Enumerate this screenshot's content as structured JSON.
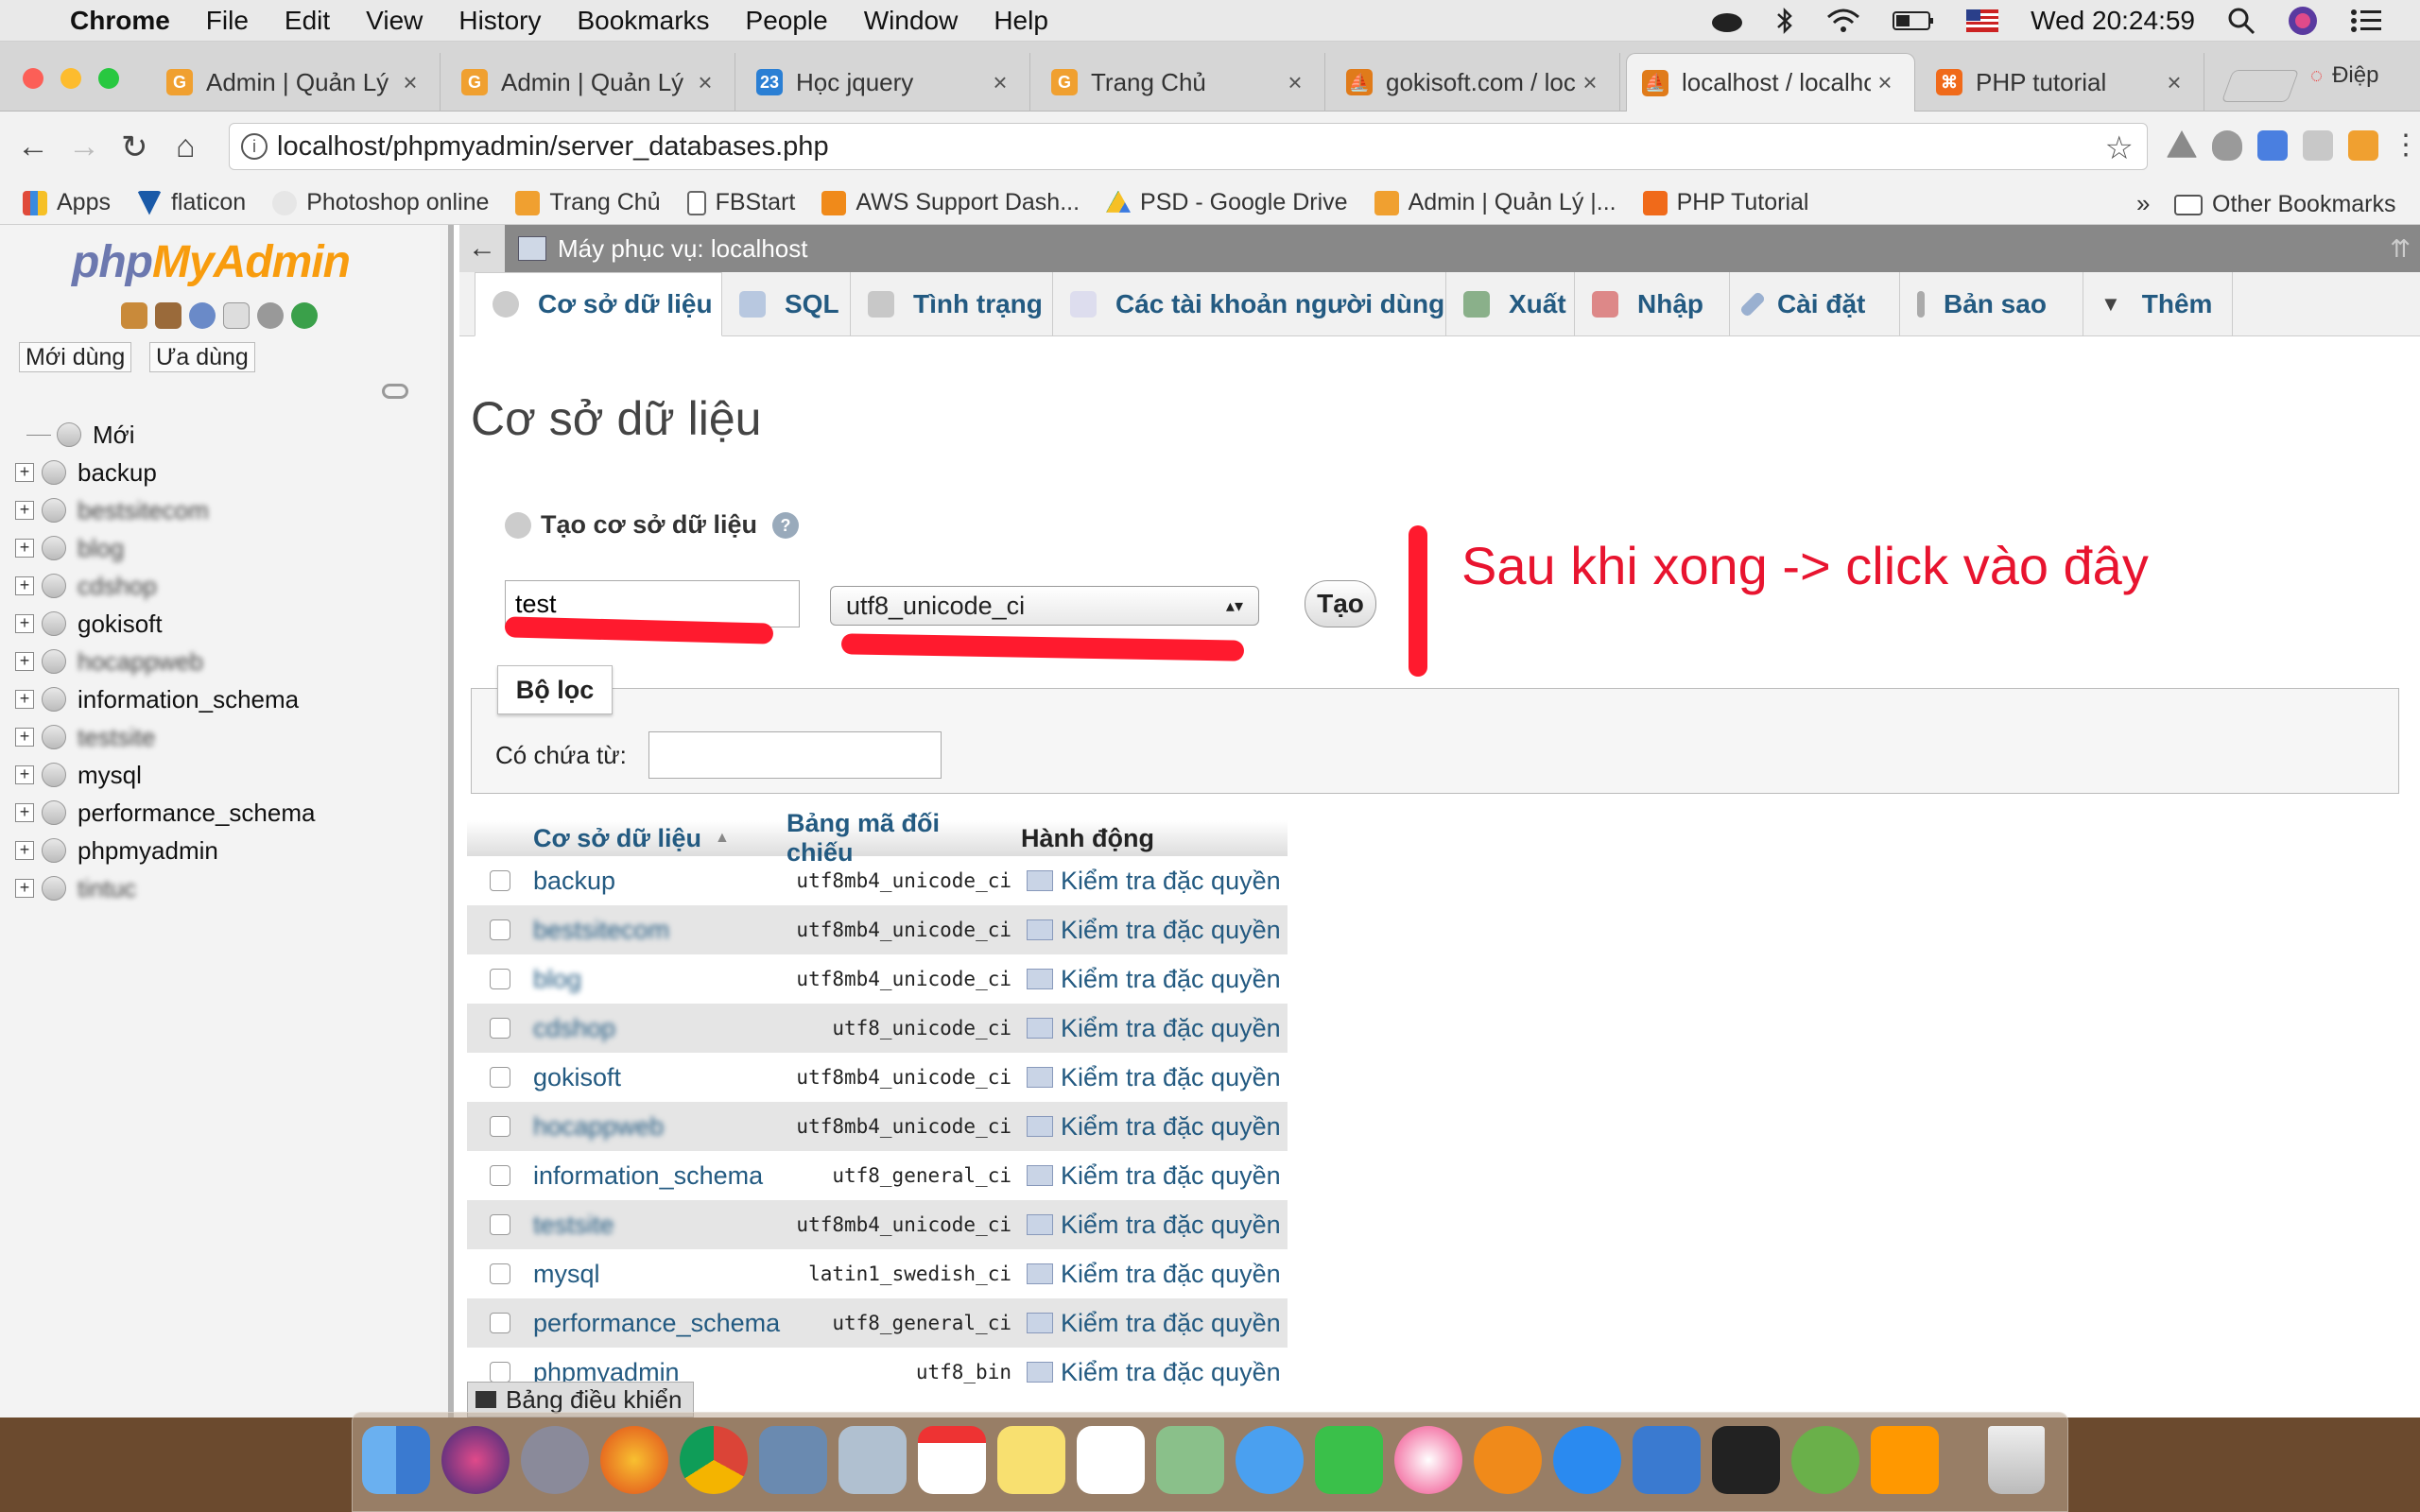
{
  "menubar": {
    "apple": "",
    "app_name": "Chrome",
    "menus": [
      "File",
      "Edit",
      "View",
      "History",
      "Bookmarks",
      "People",
      "Window",
      "Help"
    ],
    "clock": "Wed 20:24:59"
  },
  "tabs": [
    {
      "title": "Admin | Quản Lý |",
      "fav": "#f0a030"
    },
    {
      "title": "Admin | Quản Lý |",
      "fav": "#f0a030"
    },
    {
      "title": "Học jquery",
      "fav": "#2a7fd4"
    },
    {
      "title": "Trang Chủ",
      "fav": "#f0a030"
    },
    {
      "title": "gokisoft.com / loc",
      "fav": "#e07b1a"
    },
    {
      "title": "localhost / localho",
      "fav": "#e07b1a"
    },
    {
      "title": "PHP tutorial",
      "fav": "#f06a1a"
    }
  ],
  "profile_name": "Điệp",
  "url": "localhost/phpmyadmin/server_databases.php",
  "bookmarks": [
    {
      "label": "Apps",
      "color": "#e04a3a"
    },
    {
      "label": "flaticon",
      "color": "#1a5aa8"
    },
    {
      "label": "Photoshop online",
      "color": "#cccccc"
    },
    {
      "label": "Trang Chủ",
      "color": "#f0a030"
    },
    {
      "label": "FBStart",
      "color": "#ffffff"
    },
    {
      "label": "AWS Support Dash...",
      "color": "#f08a1a"
    },
    {
      "label": "PSD - Google Drive",
      "color": "#f6c026"
    },
    {
      "label": "Admin | Quản Lý |...",
      "color": "#f0a030"
    },
    {
      "label": "PHP Tutorial",
      "color": "#f06a1a"
    }
  ],
  "other_bookmarks": "Other Bookmarks",
  "sidebar": {
    "logo_php": "php",
    "logo_myadmin": "MyAdmin",
    "recent": "Mới dùng",
    "favorites": "Ưa dùng",
    "new_item": "Mới",
    "databases": [
      {
        "name": "backup",
        "blur": false
      },
      {
        "name": "bestsitecom",
        "blur": true
      },
      {
        "name": "blog",
        "blur": true
      },
      {
        "name": "cdshop",
        "blur": true
      },
      {
        "name": "gokisoft",
        "blur": false
      },
      {
        "name": "hocappweb",
        "blur": true
      },
      {
        "name": "information_schema",
        "blur": false
      },
      {
        "name": "testsite",
        "blur": true
      },
      {
        "name": "mysql",
        "blur": false
      },
      {
        "name": "performance_schema",
        "blur": false
      },
      {
        "name": "phpmyadmin",
        "blur": false
      },
      {
        "name": "tintuc",
        "blur": true
      }
    ]
  },
  "breadcrumb": "Máy phục vụ: localhost",
  "menu_tabs": [
    "Cơ sở dữ liệu",
    "SQL",
    "Tình trạng",
    "Các tài khoản người dùng",
    "Xuất",
    "Nhập",
    "Cài đặt",
    "Bản sao",
    "Thêm"
  ],
  "page_title": "Cơ sở dữ liệu",
  "create": {
    "label": "Tạo cơ sở dữ liệu",
    "db_name_value": "test",
    "collation": "utf8_unicode_ci",
    "button": "Tạo"
  },
  "annotation": "Sau khi xong -> click vào đây",
  "filter": {
    "legend": "Bộ lọc",
    "label": "Có chứa từ:",
    "value": ""
  },
  "table": {
    "headers": [
      "Cơ sở dữ liệu",
      "Bảng mã đối chiếu",
      "Hành động"
    ],
    "action_label": "Kiểm tra đặc quyền",
    "rows": [
      {
        "name": "backup",
        "collation": "utf8mb4_unicode_ci",
        "blur": false
      },
      {
        "name": "bestsitecom",
        "collation": "utf8mb4_unicode_ci",
        "blur": true
      },
      {
        "name": "blog",
        "collation": "utf8mb4_unicode_ci",
        "blur": true
      },
      {
        "name": "cdshop",
        "collation": "utf8_unicode_ci",
        "blur": true
      },
      {
        "name": "gokisoft",
        "collation": "utf8mb4_unicode_ci",
        "blur": false
      },
      {
        "name": "hocappweb",
        "collation": "utf8mb4_unicode_ci",
        "blur": true
      },
      {
        "name": "information_schema",
        "collation": "utf8_general_ci",
        "blur": false
      },
      {
        "name": "testsite",
        "collation": "utf8mb4_unicode_ci",
        "blur": true
      },
      {
        "name": "mysql",
        "collation": "latin1_swedish_ci",
        "blur": false
      },
      {
        "name": "performance_schema",
        "collation": "utf8_general_ci",
        "blur": false
      },
      {
        "name": "phpmyadmin",
        "collation": "utf8_bin",
        "blur": false
      }
    ]
  },
  "console": "Bảng điều khiển",
  "colors": {
    "link": "#235a81",
    "annotation": "#e8142f",
    "accent_orange": "#f89c0e",
    "logo_blue": "#6c78af"
  }
}
